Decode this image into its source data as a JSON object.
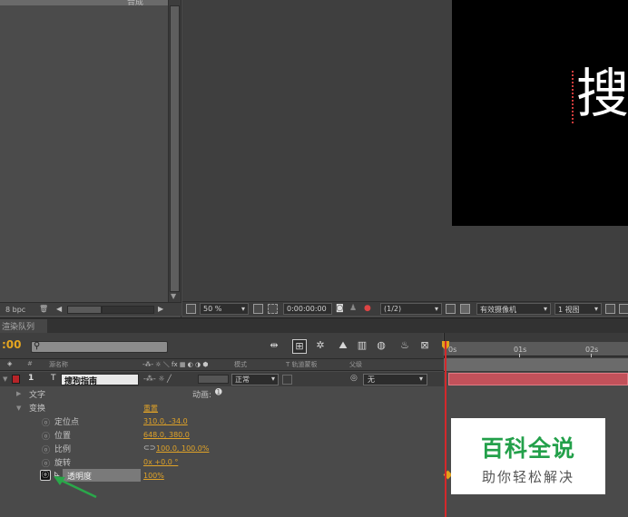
{
  "project": {
    "top_item_label": "合成",
    "bpc": "8 bpc",
    "trash_icon": "trash-icon"
  },
  "viewer": {
    "comp_text": "搜",
    "zoom": "50 %",
    "timecode": "0:00:00:00",
    "resolution": "(1/2)",
    "camera": "有效摄像机",
    "view": "1 视图"
  },
  "render_queue": {
    "tab_label": "渲染队列"
  },
  "timeline": {
    "timecode": ":00",
    "ruler": [
      "0s",
      "01s",
      "02s"
    ],
    "columns": {
      "num": "#",
      "source_name": "源名称",
      "switches": "-⁂- ☼ ＼ fx ▦ ◐ ◑ ⬢",
      "mode": "模式",
      "trkmat": "T   轨道蒙板",
      "parent": "父级"
    },
    "layer": {
      "number": "1",
      "name": "搜狗指南",
      "mode": "正常",
      "parent": "无"
    },
    "groups": {
      "text": "文字",
      "animate": "动画: ",
      "transform": "变换",
      "reset": "重置"
    },
    "properties": [
      {
        "label": "定位点",
        "value": "310.0, -34.0"
      },
      {
        "label": "位置",
        "value": "648.0, 380.0"
      },
      {
        "label": "比例",
        "value": "100.0, 100.0%"
      },
      {
        "label": "旋转",
        "value": "0x +0.0 °"
      },
      {
        "label": "透明度",
        "value": "100%"
      }
    ]
  },
  "watermark": {
    "title": "百科全说",
    "subtitle": "助你轻松解决"
  },
  "colors": {
    "accent": "#e1a327",
    "layer_label": "#b72428",
    "layer_bar": "#c2515a",
    "arrow": "#2aa84a",
    "watermark_green": "#23a04a"
  }
}
